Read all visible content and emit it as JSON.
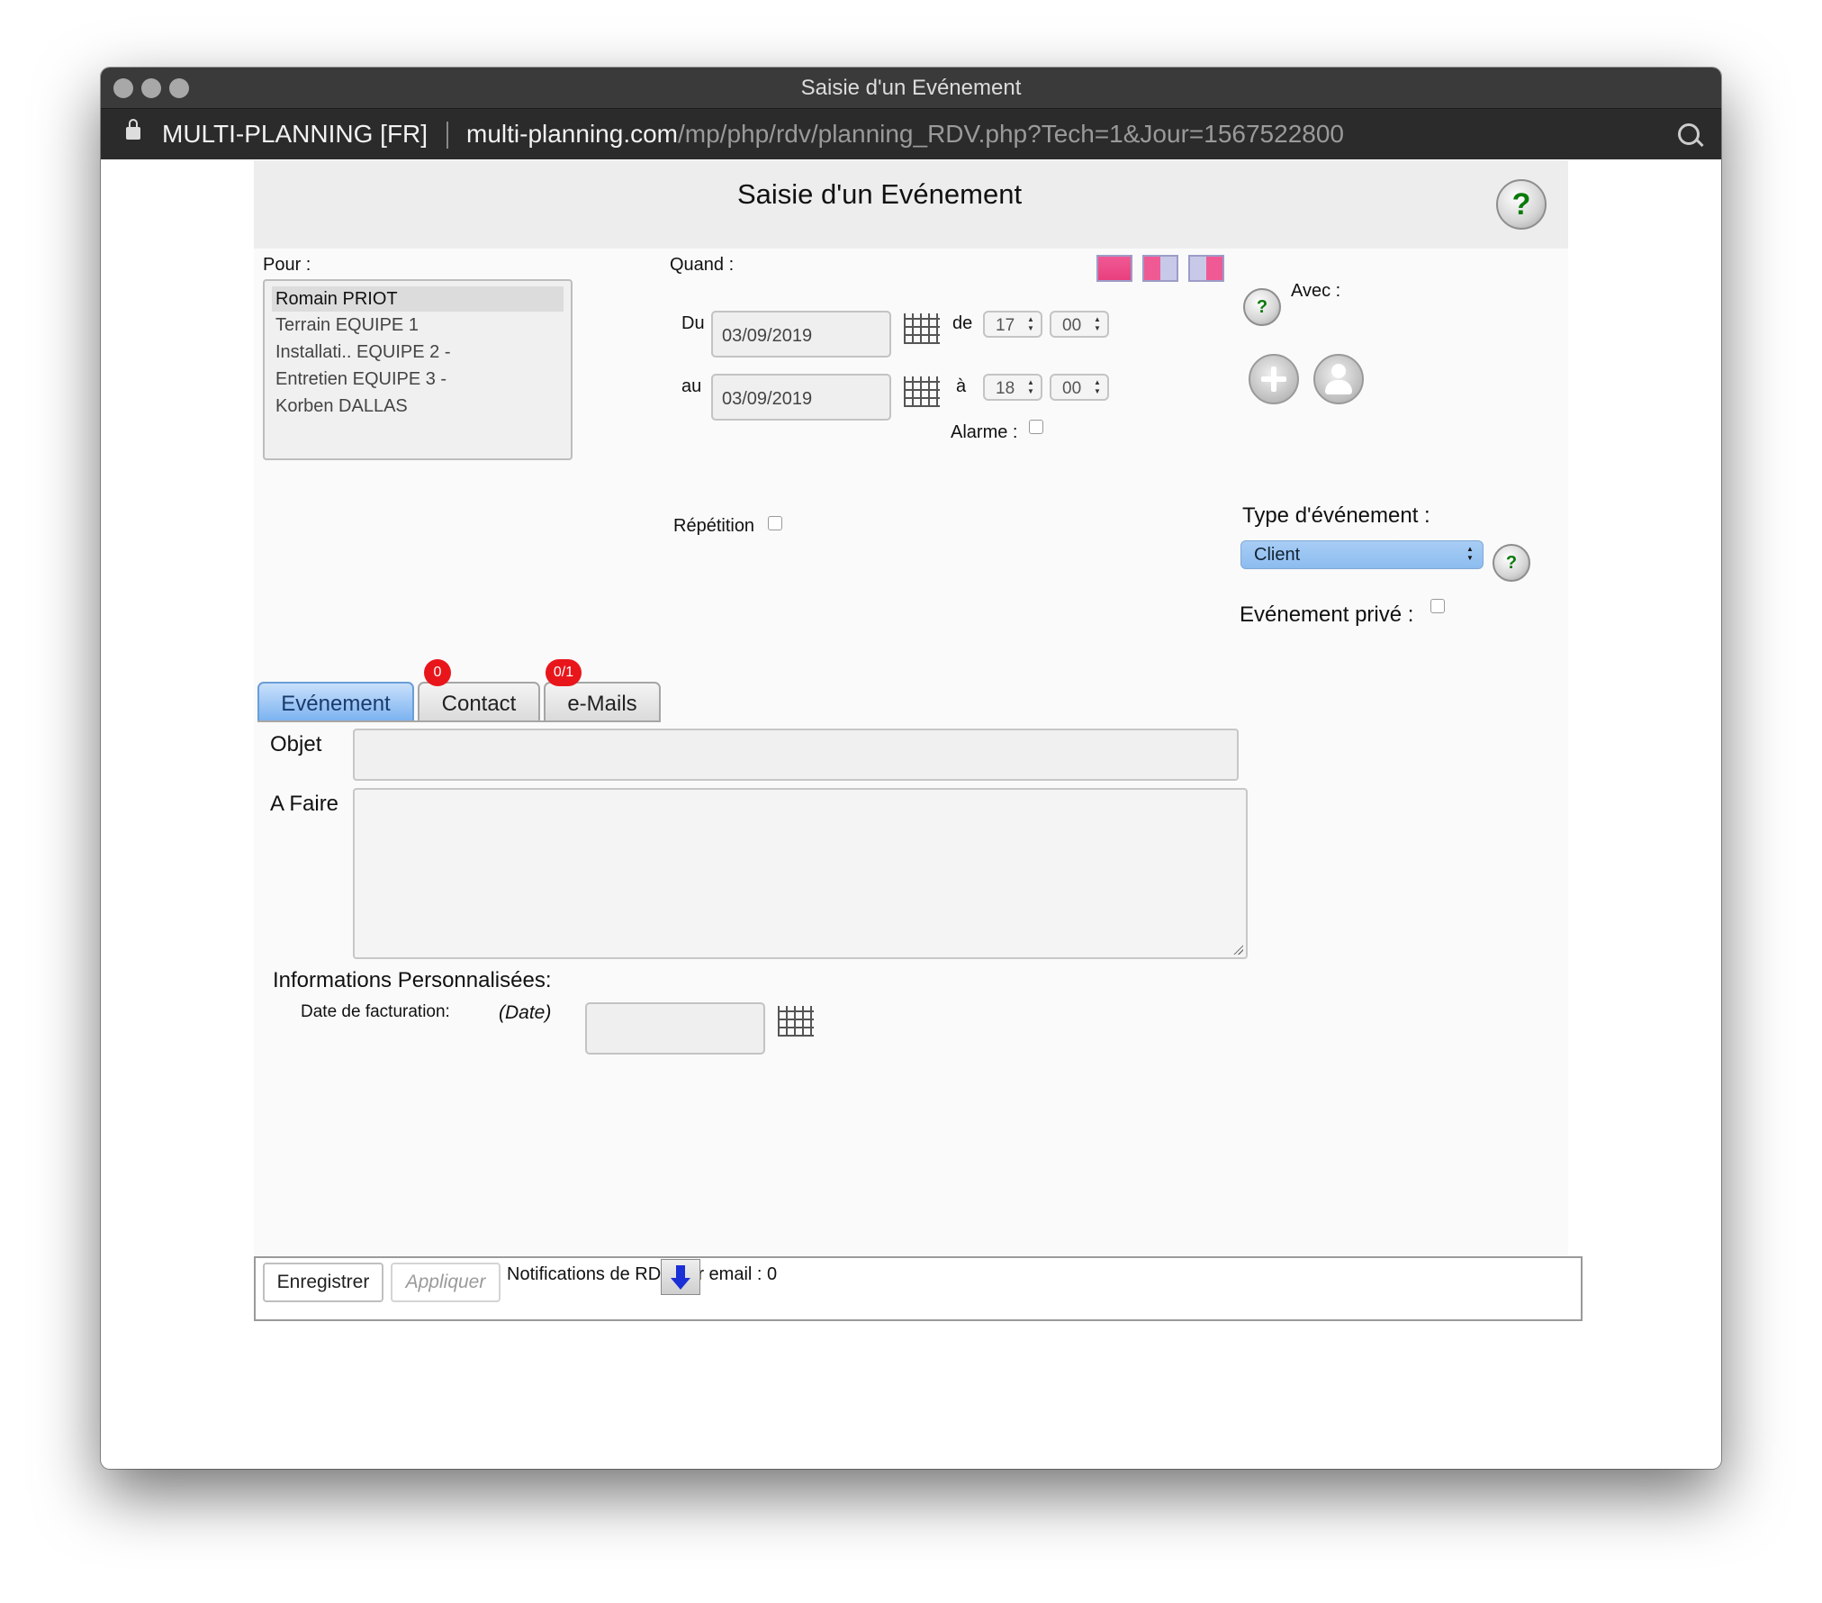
{
  "window": {
    "title": "Saisie d'un Evénement",
    "site_name": "MULTI-PLANNING [FR]",
    "url_host": "multi-planning.com",
    "url_path": "/mp/php/rdv/planning_RDV.php?Tech=1&Jour=1567522800"
  },
  "page": {
    "title": "Saisie d'un Evénement",
    "help_label": "?"
  },
  "pour": {
    "label": "Pour :",
    "items": [
      "Romain PRIOT",
      "Terrain EQUIPE 1",
      "Installati.. EQUIPE 2 -",
      "Entretien EQUIPE 3 -",
      "Korben DALLAS"
    ],
    "selected": "Romain PRIOT"
  },
  "quand": {
    "label": "Quand :",
    "du_label": "Du",
    "du_date": "03/09/2019",
    "de_label": "de",
    "de_hour": "17",
    "de_min": "00",
    "au_label": "au",
    "au_date": "03/09/2019",
    "a_label": "à",
    "a_hour": "18",
    "a_min": "00",
    "alarme_label": "Alarme :",
    "repetition_label": "Répétition"
  },
  "avec": {
    "label": "Avec :"
  },
  "type": {
    "label": "Type d'événement :",
    "selected": "Client",
    "private_label": "Evénement privé :"
  },
  "tabs": [
    {
      "label": "Evénement",
      "badge": ""
    },
    {
      "label": "Contact",
      "badge": "0"
    },
    {
      "label": "e-Mails",
      "badge": "0/1"
    }
  ],
  "form": {
    "objet_label": "Objet",
    "afaire_label": "A Faire",
    "info_title": "Informations Personnalisées:",
    "facturation_label": "Date de facturation:",
    "facturation_hint": "(Date)"
  },
  "footer": {
    "save_label": "Enregistrer",
    "apply_label": "Appliquer",
    "notif_text": "Notifications de RDV par email : 0"
  },
  "colors": {
    "tab_active": "#7ab2f0",
    "badge": "#e8161b",
    "select_bg": "#a8cdf5",
    "color_swatch": "#f0508c"
  }
}
